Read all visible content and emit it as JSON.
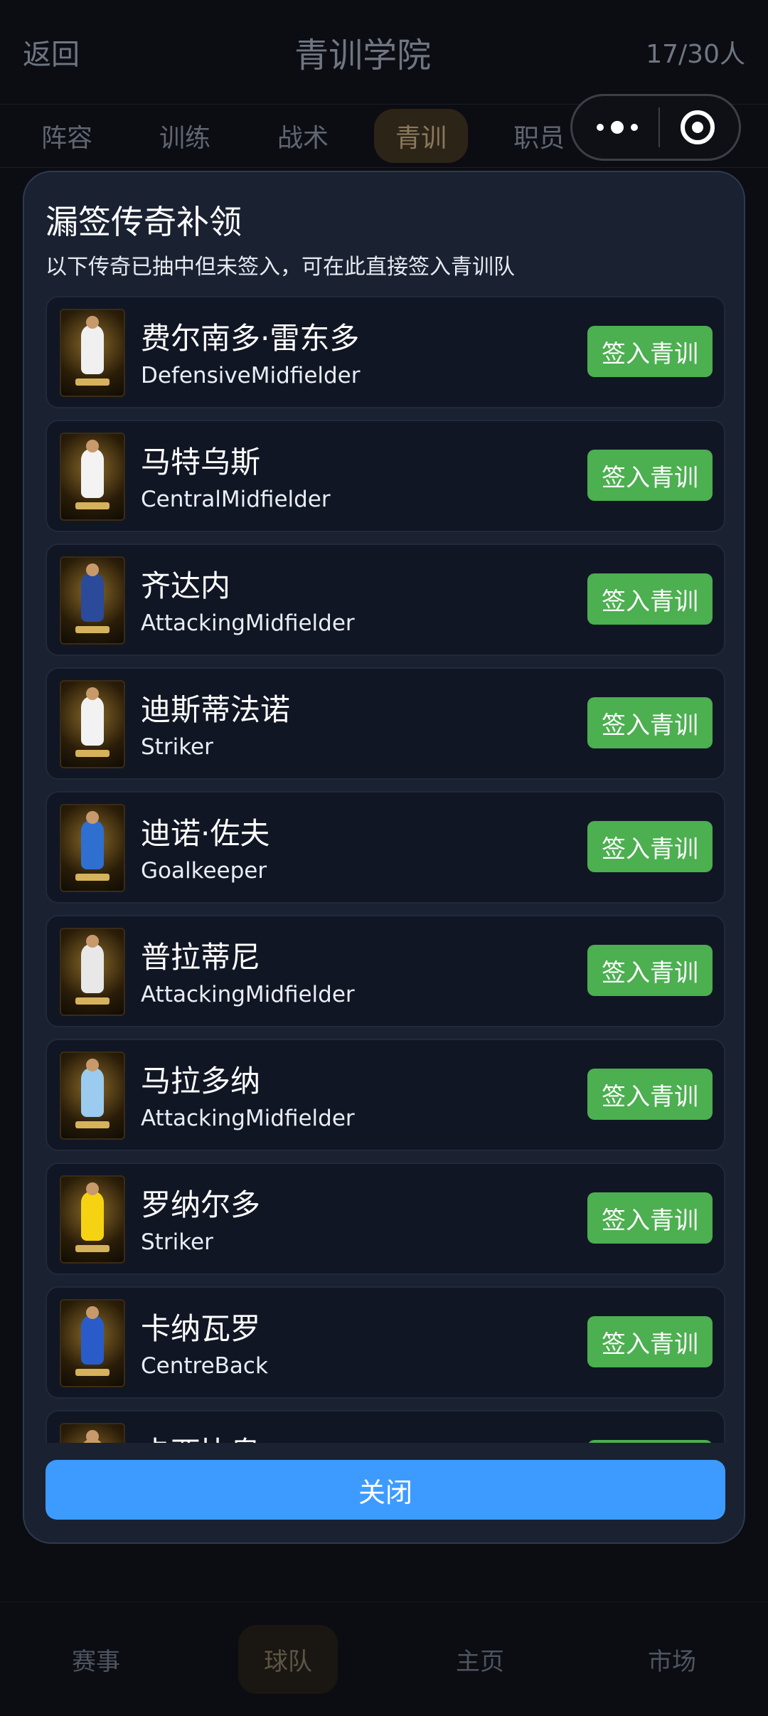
{
  "topbar": {
    "back": "返回",
    "title": "青训学院",
    "count": "17/30人"
  },
  "tabs": [
    "阵容",
    "训练",
    "战术",
    "青训",
    "职员"
  ],
  "bottom_nav": [
    "赛事",
    "球队",
    "主页",
    "市场"
  ],
  "modal": {
    "title": "漏签传奇补领",
    "subtitle": "以下传奇已抽中但未签入，可在此直接签入青训队",
    "close_label": "关闭",
    "sign_label": "签入青训",
    "players": [
      {
        "name": "费尔南多·雷东多",
        "position": "DefensiveMidfielder",
        "kit": "#f0f0f0"
      },
      {
        "name": "马特乌斯",
        "position": "CentralMidfielder",
        "kit": "#f3f3f3"
      },
      {
        "name": "齐达内",
        "position": "AttackingMidfielder",
        "kit": "#2b4a9a"
      },
      {
        "name": "迪斯蒂法诺",
        "position": "Striker",
        "kit": "#f2f2f2"
      },
      {
        "name": "迪诺·佐夫",
        "position": "Goalkeeper",
        "kit": "#2f6fd0"
      },
      {
        "name": "普拉蒂尼",
        "position": "AttackingMidfielder",
        "kit": "#e8e8e8"
      },
      {
        "name": "马拉多纳",
        "position": "AttackingMidfielder",
        "kit": "#9ccbf0"
      },
      {
        "name": "罗纳尔多",
        "position": "Striker",
        "kit": "#f5d312"
      },
      {
        "name": "卡纳瓦罗",
        "position": "CentreBack",
        "kit": "#2a5cc9"
      },
      {
        "name": "卡西比奥",
        "position": "",
        "kit": "#d0a050"
      }
    ]
  },
  "colors": {
    "accent_green": "#4caf50",
    "accent_blue": "#3d9bff",
    "modal_bg": "#1a2131"
  }
}
